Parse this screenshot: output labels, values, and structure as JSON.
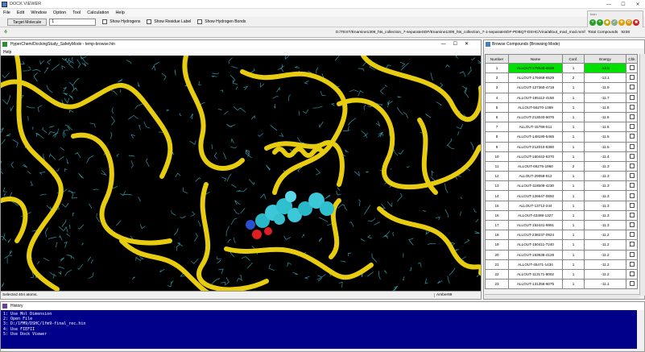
{
  "app": {
    "title": "DOCK VIEWER"
  },
  "menu": [
    "File",
    "Edit",
    "Window",
    "Option",
    "Tool",
    "Calculation",
    "Help"
  ],
  "toolbar1": {
    "target_button": "Target Molecule",
    "target_value": "1",
    "show_hydrogens": "Show Hydrogens",
    "show_residue": "Show Residue Label",
    "show_hbonds": "Show Hydrogen Bonds"
  },
  "toolbar2": {
    "path": "D:/TEST/Enamine1309_hts_collection_7-separateSDF/Enamine1309_hts_collection_7-1-separateSDF-PDBQT-DSHC/Vina/allout_mod_mod.mmf",
    "total_label": "Total Compounds",
    "total_value": "9238"
  },
  "mini_panel": {
    "label": "Icon"
  },
  "hyperchem": {
    "title": "HyperChem/DockingStudy_SafetyMode - temp-browse.hin",
    "menu": "Help",
    "status_left": "Selected 404 atoms.",
    "status_right": "Amber99"
  },
  "browse": {
    "title": "Browse Compounds (Browsing Mode)",
    "headers": [
      "Number",
      "Name",
      "Conf.",
      "Energy",
      "Chk"
    ],
    "rows": [
      {
        "n": "1",
        "name": "ALLOUT-179440-4538",
        "conf": "1",
        "energy": "-12.5"
      },
      {
        "n": "2",
        "name": "ALLOUT-179469-6529",
        "conf": "2",
        "energy": "-12.1"
      },
      {
        "n": "3",
        "name": "ALLOUT-127360-4719",
        "conf": "1",
        "energy": "-11.9"
      },
      {
        "n": "4",
        "name": "ALLOUT-165112-4158",
        "conf": "1",
        "energy": "-11.7"
      },
      {
        "n": "5",
        "name": "ALLOUT-56270-1369",
        "conf": "1",
        "energy": "-11.6"
      },
      {
        "n": "6",
        "name": "ALLOUT-213040-5076",
        "conf": "1",
        "energy": "-11.6"
      },
      {
        "n": "7",
        "name": "ALLOUT-15788-511",
        "conf": "1",
        "energy": "-11.5"
      },
      {
        "n": "8",
        "name": "ALLOUT-148180-5465",
        "conf": "1",
        "energy": "-11.5"
      },
      {
        "n": "9",
        "name": "ALLOUT-212010-8380",
        "conf": "1",
        "energy": "-11.5"
      },
      {
        "n": "10",
        "name": "ALLOUT-160442-6370",
        "conf": "1",
        "energy": "-11.4"
      },
      {
        "n": "11",
        "name": "ALLOUT-66276-1960",
        "conf": "2",
        "energy": "-11.3"
      },
      {
        "n": "12",
        "name": "ALLOUT-29058-912",
        "conf": "1",
        "energy": "-11.3"
      },
      {
        "n": "13",
        "name": "ALLOUT-118509-4230",
        "conf": "1",
        "energy": "-11.3"
      },
      {
        "n": "14",
        "name": "ALLOUT-126647-0692",
        "conf": "1",
        "energy": "-11.3"
      },
      {
        "n": "15",
        "name": "ALLOUT-13712-244",
        "conf": "1",
        "energy": "-11.3"
      },
      {
        "n": "16",
        "name": "ALLOUT-43488-1327",
        "conf": "1",
        "energy": "-11.3"
      },
      {
        "n": "17",
        "name": "ALLOUT-152441-6991",
        "conf": "1",
        "energy": "-11.3"
      },
      {
        "n": "18",
        "name": "ALLOUT-238237-0924",
        "conf": "1",
        "energy": "-11.2"
      },
      {
        "n": "19",
        "name": "ALLOUT-150411-7240",
        "conf": "1",
        "energy": "-11.2"
      },
      {
        "n": "20",
        "name": "ALLOUT-163638-4128",
        "conf": "1",
        "energy": "-11.2"
      },
      {
        "n": "21",
        "name": "ALLOUT-45471-1434",
        "conf": "1",
        "energy": "-11.2"
      },
      {
        "n": "22",
        "name": "ALLOUT-113171-8002",
        "conf": "1",
        "energy": "-11.2"
      },
      {
        "n": "23",
        "name": "ALLOUT-131356-6075",
        "conf": "1",
        "energy": "-11.1"
      }
    ]
  },
  "history": {
    "title": "History",
    "items": [
      "1: Use Mol Dimension",
      "2: Open File",
      "3: D:/1FM9/DSHC/1fm9-final_rec.hin",
      "4: Use FIEFII",
      "5: Use Dock Viewer"
    ]
  },
  "colors": {
    "selection": "#00e000",
    "history_bg": "#00008b",
    "ribbon": "#ffd700",
    "ligand": "#40e0e0"
  }
}
